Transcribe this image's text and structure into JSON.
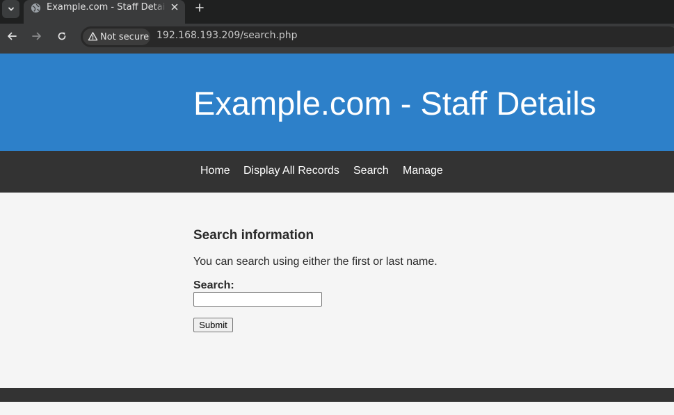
{
  "browser": {
    "tab": {
      "title": "Example.com - Staff Details"
    },
    "security_label": "Not secure",
    "url": "192.168.193.209/search.php",
    "icons": {
      "tab_menu": "chevron-down-icon",
      "favicon": "globe-icon",
      "tab_close": "close-icon",
      "new_tab": "plus-icon",
      "back": "arrow-left-icon",
      "forward": "arrow-right-icon",
      "reload": "reload-icon",
      "security": "warning-triangle-icon"
    }
  },
  "page": {
    "header": {
      "title": "Example.com - Staff Details",
      "color": "#2d80c9"
    },
    "nav": {
      "color": "#333333",
      "items": [
        {
          "label": "Home"
        },
        {
          "label": "Display All Records"
        },
        {
          "label": "Search"
        },
        {
          "label": "Manage"
        }
      ]
    },
    "content": {
      "heading": "Search information",
      "description": "You can search using either the first or last name.",
      "search_label": "Search:",
      "search_value": "",
      "submit_label": "Submit"
    }
  }
}
